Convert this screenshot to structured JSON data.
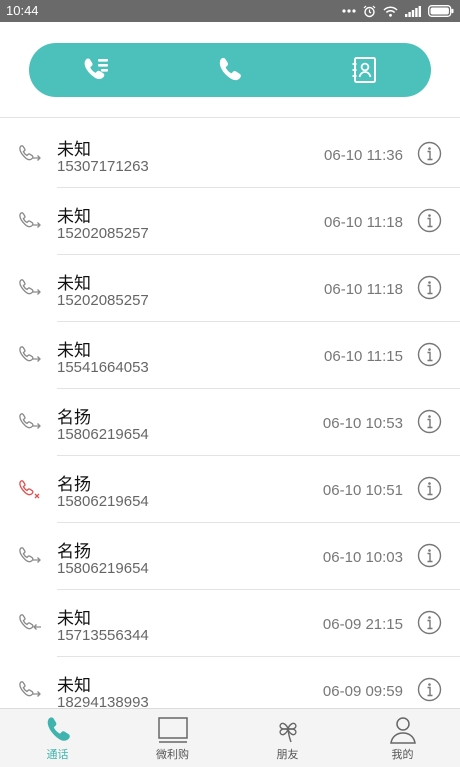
{
  "status_bar": {
    "time": "10:44",
    "icons": [
      "more-dots-icon",
      "alarm-icon",
      "wifi-icon",
      "signal-icon",
      "battery-icon"
    ]
  },
  "top_tabs": [
    {
      "icon": "call-log-icon",
      "active": true
    },
    {
      "icon": "dialer-phone-icon",
      "active": false
    },
    {
      "icon": "contacts-book-icon",
      "active": false
    }
  ],
  "calls": [
    {
      "name": "未知",
      "number": "15307171263",
      "time": "06-10 11:36",
      "type": "outgoing"
    },
    {
      "name": "未知",
      "number": "15202085257",
      "time": "06-10 11:18",
      "type": "outgoing"
    },
    {
      "name": "未知",
      "number": "15202085257",
      "time": "06-10 11:18",
      "type": "outgoing"
    },
    {
      "name": "未知",
      "number": "15541664053",
      "time": "06-10 11:15",
      "type": "outgoing"
    },
    {
      "name": "名扬",
      "number": "15806219654",
      "time": "06-10 10:53",
      "type": "outgoing"
    },
    {
      "name": "名扬",
      "number": "15806219654",
      "time": "06-10 10:51",
      "type": "missed"
    },
    {
      "name": "名扬",
      "number": "15806219654",
      "time": "06-10 10:03",
      "type": "outgoing"
    },
    {
      "name": "未知",
      "number": "15713556344",
      "time": "06-09 21:15",
      "type": "incoming"
    },
    {
      "name": "未知",
      "number": "18294138993",
      "time": "06-09 09:59",
      "type": "outgoing"
    }
  ],
  "bottom_nav": [
    {
      "label": "通话",
      "icon": "phone-icon",
      "active": true
    },
    {
      "label": "微利购",
      "icon": "tv-screen-icon",
      "active": false
    },
    {
      "label": "朋友",
      "icon": "clover-icon",
      "active": false
    },
    {
      "label": "我的",
      "icon": "user-icon",
      "active": false
    }
  ],
  "colors": {
    "accent": "#4cc1bb",
    "missed": "#e0514f",
    "status_bar": "#6a6a6a"
  }
}
